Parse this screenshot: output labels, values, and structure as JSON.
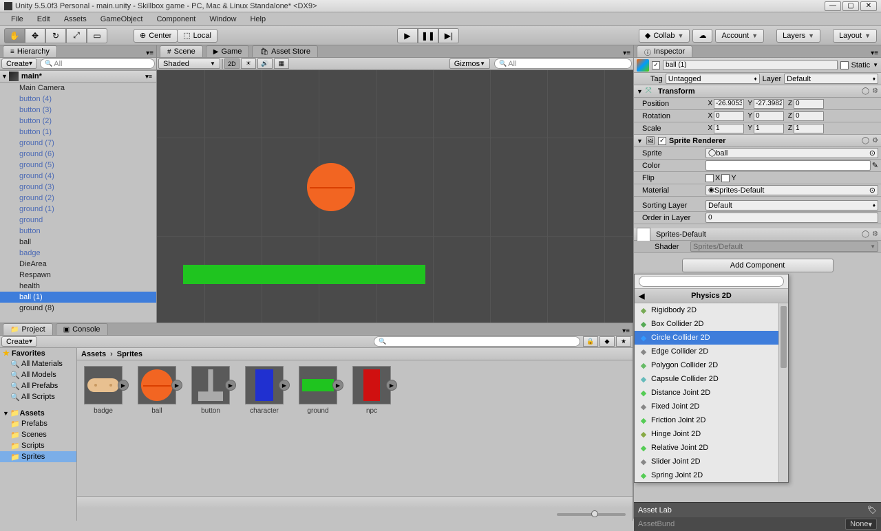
{
  "window": {
    "title": "Unity 5.5.0f3 Personal - main.unity - Skillbox game - PC, Mac & Linux Standalone* <DX9>"
  },
  "menubar": [
    "File",
    "Edit",
    "Assets",
    "GameObject",
    "Component",
    "Window",
    "Help"
  ],
  "toolbar": {
    "center": "Center",
    "local": "Local",
    "collab": "Collab",
    "account": "Account",
    "layers": "Layers",
    "layout": "Layout"
  },
  "panels": {
    "hierarchy": "Hierarchy",
    "scene": "Scene",
    "game": "Game",
    "asset_store": "Asset Store",
    "project": "Project",
    "console": "Console",
    "inspector": "Inspector"
  },
  "hierarchy": {
    "create": "Create",
    "search_placeholder": "All",
    "scene_name": "main*",
    "items": [
      {
        "label": "Main Camera",
        "blue": false
      },
      {
        "label": "button (4)",
        "blue": true
      },
      {
        "label": "button (3)",
        "blue": true
      },
      {
        "label": "button (2)",
        "blue": true
      },
      {
        "label": "button (1)",
        "blue": true
      },
      {
        "label": "ground (7)",
        "blue": true
      },
      {
        "label": "ground (6)",
        "blue": true
      },
      {
        "label": "ground (5)",
        "blue": true
      },
      {
        "label": "ground (4)",
        "blue": true
      },
      {
        "label": "ground (3)",
        "blue": true
      },
      {
        "label": "ground (2)",
        "blue": true
      },
      {
        "label": "ground (1)",
        "blue": true
      },
      {
        "label": "ground",
        "blue": true
      },
      {
        "label": "button",
        "blue": true
      },
      {
        "label": "ball",
        "blue": false
      },
      {
        "label": "badge",
        "blue": true
      },
      {
        "label": "DieArea",
        "blue": false
      },
      {
        "label": "Respawn",
        "blue": false
      },
      {
        "label": "health",
        "blue": false
      },
      {
        "label": "ball (1)",
        "blue": false,
        "selected": true
      },
      {
        "label": "ground (8)",
        "blue": false
      }
    ]
  },
  "scene_toolbar": {
    "shaded": "Shaded",
    "mode_2d": "2D",
    "gizmos": "Gizmos",
    "search_placeholder": "All"
  },
  "project": {
    "create": "Create",
    "favorites": "Favorites",
    "fav_items": [
      "All Materials",
      "All Models",
      "All Prefabs",
      "All Scripts"
    ],
    "assets_root": "Assets",
    "folders": [
      "Prefabs",
      "Scenes",
      "Scripts",
      "Sprites"
    ],
    "selected_folder": "Sprites",
    "breadcrumb": [
      "Assets",
      "Sprites"
    ],
    "assets": [
      "badge",
      "ball",
      "button",
      "character",
      "ground",
      "npc"
    ]
  },
  "inspector": {
    "name": "ball (1)",
    "static": "Static",
    "tag_label": "Tag",
    "tag": "Untagged",
    "layer_label": "Layer",
    "layer": "Default",
    "transform": {
      "title": "Transform",
      "position_label": "Position",
      "position": {
        "x": "-26.9053",
        "y": "-27.39824",
        "z": "0"
      },
      "rotation_label": "Rotation",
      "rotation": {
        "x": "0",
        "y": "0",
        "z": "0"
      },
      "scale_label": "Scale",
      "scale": {
        "x": "1",
        "y": "1",
        "z": "1"
      }
    },
    "sprite_renderer": {
      "title": "Sprite Renderer",
      "sprite_label": "Sprite",
      "sprite": "ball",
      "color_label": "Color",
      "flip_label": "Flip",
      "flip_x": "X",
      "flip_y": "Y",
      "material_label": "Material",
      "material": "Sprites-Default",
      "sorting_layer_label": "Sorting Layer",
      "sorting_layer": "Default",
      "order_label": "Order in Layer",
      "order": "0"
    },
    "material_preview": {
      "name": "Sprites-Default",
      "shader_label": "Shader",
      "shader": "Sprites/Default"
    },
    "add_component": "Add Component"
  },
  "component_dropdown": {
    "category": "Physics 2D",
    "items": [
      "Rigidbody 2D",
      "Box Collider 2D",
      "Circle Collider 2D",
      "Edge Collider 2D",
      "Polygon Collider 2D",
      "Capsule Collider 2D",
      "Distance Joint 2D",
      "Fixed Joint 2D",
      "Friction Joint 2D",
      "Hinge Joint 2D",
      "Relative Joint 2D",
      "Slider Joint 2D",
      "Spring Joint 2D"
    ],
    "selected": "Circle Collider 2D"
  },
  "asset_labels": {
    "title": "Asset Lab",
    "bundle_label": "AssetBund",
    "none": "None"
  }
}
